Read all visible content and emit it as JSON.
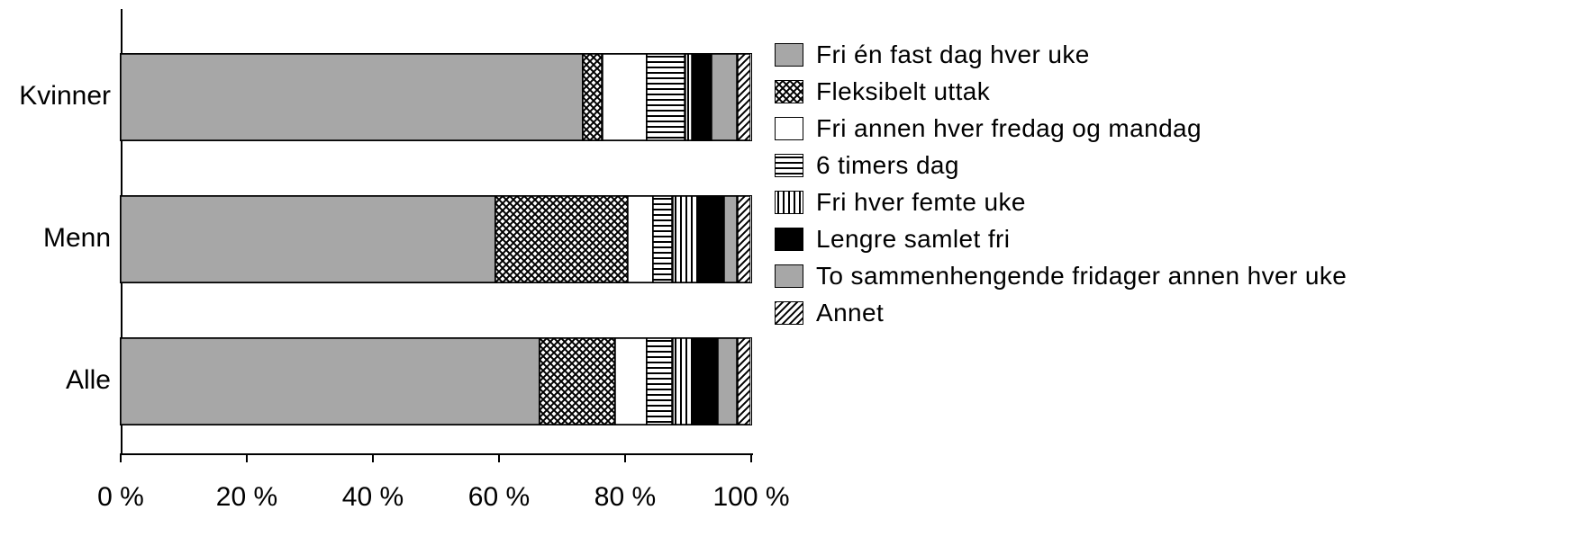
{
  "chart_data": {
    "type": "bar",
    "orientation": "horizontal-stacked-100",
    "categories": [
      "Kvinner",
      "Menn",
      "Alle"
    ],
    "series": [
      {
        "name": "Fri én fast dag hver uke",
        "pattern": "solid-grey",
        "values": [
          74,
          60,
          67
        ]
      },
      {
        "name": "Fleksibelt uttak",
        "pattern": "crosshatch-dark",
        "values": [
          3,
          21,
          12
        ]
      },
      {
        "name": "Fri annen hver fredag og mandag",
        "pattern": "solid-white",
        "values": [
          7,
          4,
          5
        ]
      },
      {
        "name": "6 timers dag",
        "pattern": "h-stripes",
        "values": [
          6,
          3,
          4
        ]
      },
      {
        "name": "Fri hver femte uke",
        "pattern": "v-stripes",
        "values": [
          1,
          4,
          3
        ]
      },
      {
        "name": "Lengre samlet fri",
        "pattern": "solid-black",
        "values": [
          3,
          4,
          4
        ]
      },
      {
        "name": "To sammenhengende fridager annen hver uke",
        "pattern": "solid-grey",
        "values": [
          4,
          2,
          3
        ]
      },
      {
        "name": "Annet",
        "pattern": "diag-stripes",
        "values": [
          2,
          2,
          2
        ]
      }
    ],
    "xticks": [
      "0 %",
      "20 %",
      "40 %",
      "60 %",
      "80 %",
      "100 %"
    ],
    "xlim": [
      0,
      100
    ]
  },
  "colors": {
    "grey": "#a7a7a7",
    "darkgrey": "#5a5a5a",
    "black": "#000000",
    "white": "#ffffff"
  }
}
